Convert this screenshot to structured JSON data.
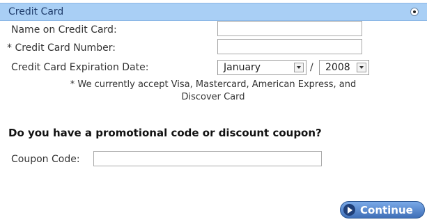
{
  "credit_card": {
    "header": "Credit Card",
    "name_label": "Name on Credit Card:",
    "number_label": "* Credit Card Number:",
    "expiration_label": "Credit Card Expiration Date:",
    "month": "January",
    "separator": "/",
    "year": "2008",
    "note_line1": "* We currently accept Visa, Mastercard, American Express, and",
    "note_line2": "Discover Card"
  },
  "promo": {
    "title": "Do you have a promotional code or discount coupon?",
    "coupon_label": "Coupon Code:"
  },
  "actions": {
    "continue_label": "Continue"
  },
  "icons": {
    "radio": "radio-selected-icon",
    "continue": "play-circle-icon"
  }
}
